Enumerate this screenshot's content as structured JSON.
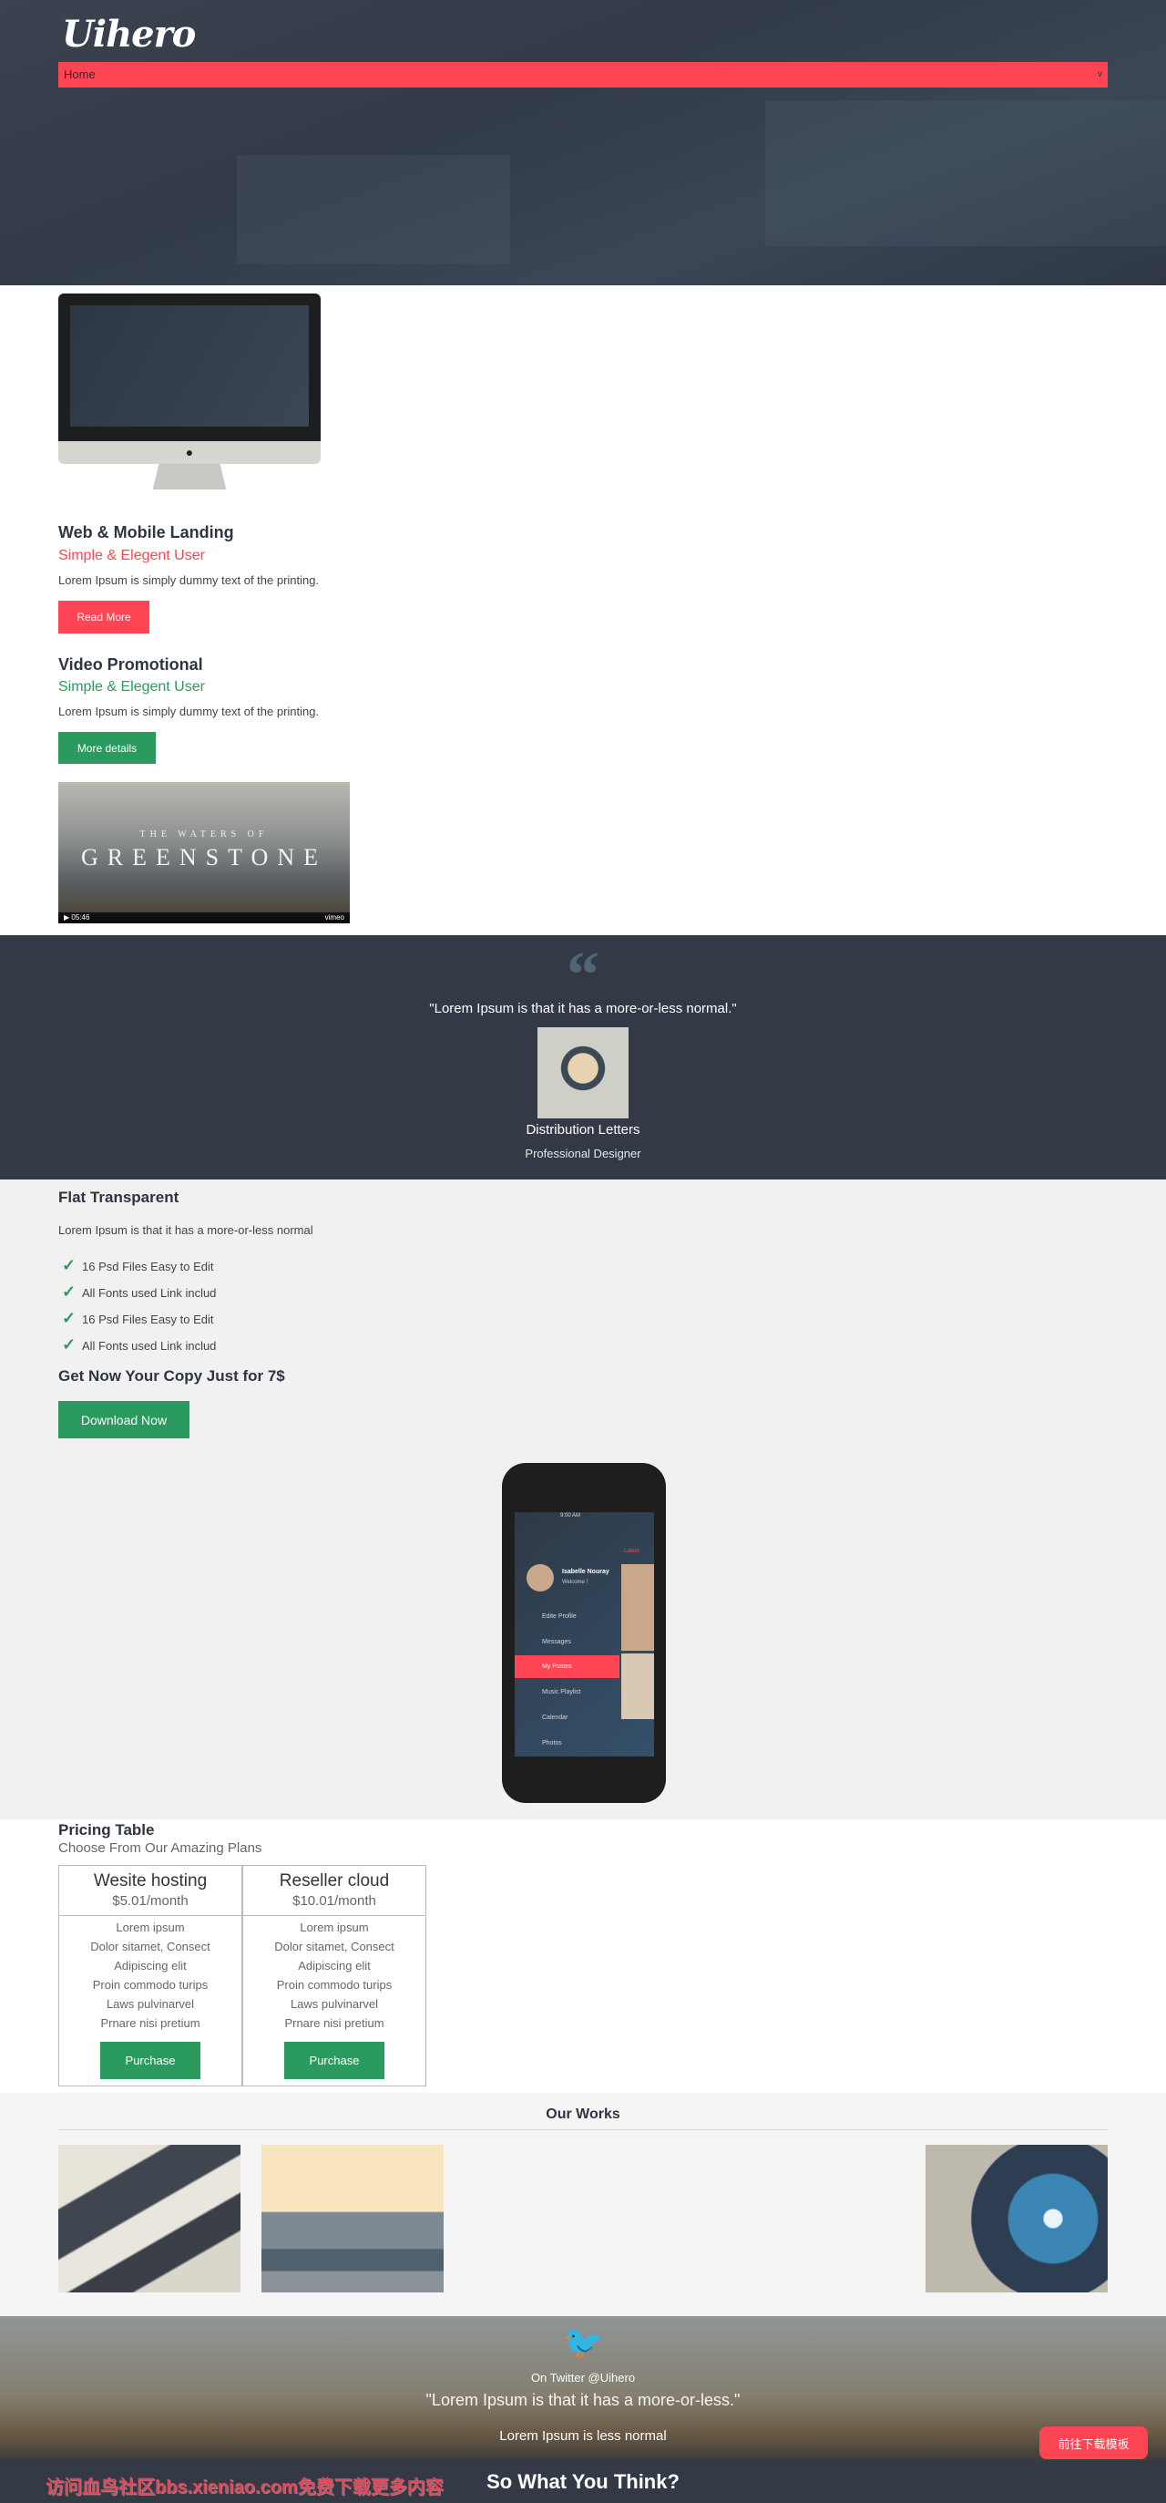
{
  "header": {
    "logo": "Uihero",
    "nav_selected": "Home"
  },
  "features": [
    {
      "title": "Web & Mobile Landing",
      "subtitle": "Simple & Elegent User",
      "text": "Lorem Ipsum is simply dummy text of the printing.",
      "button": "Read More"
    },
    {
      "title": "Video Promotional",
      "subtitle": "Simple & Elegent User",
      "text": "Lorem Ipsum is simply dummy text of the printing.",
      "button": "More details"
    }
  ],
  "video": {
    "kicker": "THE WATERS OF",
    "title": "GREENSTONE",
    "duration": "05:46",
    "brand": "vimeo"
  },
  "testimonial": {
    "quote": "\"Lorem Ipsum is that it has a more-or-less normal.\"",
    "name": "Distribution Letters",
    "role": "Professional Designer"
  },
  "flat": {
    "title": "Flat Transparent",
    "text": "Lorem Ipsum is that it has a more-or-less normal",
    "items": [
      "16 Psd Files Easy to Edit",
      "All Fonts used Link includ",
      "16 Psd Files Easy to Edit",
      "All Fonts used Link includ"
    ],
    "cta": "Get Now Your Copy Just for 7$",
    "button": "Download Now"
  },
  "phone": {
    "time": "9:00 AM",
    "user": "Isabelle Nouray",
    "welcome": "Welcome !",
    "menu": [
      "Edite Profile",
      "Messages",
      "My Postes",
      "Music Playlist",
      "Calendar",
      "Photos"
    ],
    "latest": "Latest"
  },
  "pricing": {
    "title": "Pricing Table",
    "subtitle": "Choose From Our Amazing Plans",
    "plans": [
      {
        "name": "Wesite hosting",
        "price": "$5.01/month",
        "features": [
          "Lorem ipsum",
          "Dolor sitamet, Consect",
          "Adipiscing elit",
          "Proin commodo turips",
          "Laws pulvinarvel",
          "Prnare nisi pretium"
        ],
        "button": "Purchase"
      },
      {
        "name": "Reseller cloud",
        "price": "$10.01/month",
        "features": [
          "Lorem ipsum",
          "Dolor sitamet, Consect",
          "Adipiscing elit",
          "Proin commodo turips",
          "Laws pulvinarvel",
          "Prnare nisi pretium"
        ],
        "button": "Purchase"
      }
    ]
  },
  "works": {
    "title": "Our Works"
  },
  "twitter": {
    "handle": "On Twitter @Uihero",
    "quote": "\"Lorem Ipsum is that it has a more-or-less.\"",
    "text": "Lorem Ipsum is less normal"
  },
  "footer": {
    "title": "So What You Think?",
    "watermark": "访问血鸟社区bbs.xieniao.com免费下载更多内容",
    "download_button": "前往下载模板"
  },
  "colors": {
    "accent_red": "#ff4553",
    "accent_green": "#2a9a5e",
    "dark": "#333a46"
  }
}
